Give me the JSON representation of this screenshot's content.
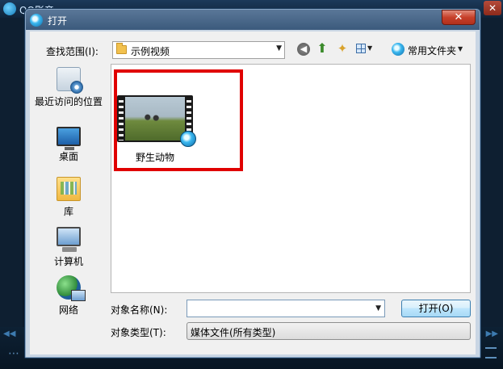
{
  "app": {
    "title": "QQ影音",
    "close_glyph": "✕"
  },
  "player": {
    "skip_left": "◀◀",
    "skip_right": "▶▶",
    "foot_icon": "⋯"
  },
  "dialog": {
    "title": "打开",
    "close_glyph": "✕",
    "look_in": {
      "label": "查找范围(I):",
      "value": "示例视频",
      "arrow": "▼"
    },
    "toolbar": {
      "back_glyph": "◀",
      "up_glyph": "⬆",
      "new_folder_glyph": "✦",
      "view_arrow": "▼",
      "favorites_label": "常用文件夹",
      "favorites_arrow": "▼"
    },
    "places": [
      {
        "label": "最近访问的位置",
        "icon": "recent-places-icon"
      },
      {
        "label": "桌面",
        "icon": "desktop-icon"
      },
      {
        "label": "库",
        "icon": "library-icon"
      },
      {
        "label": "计算机",
        "icon": "computer-icon"
      },
      {
        "label": "网络",
        "icon": "network-icon"
      }
    ],
    "files": [
      {
        "name": "野生动物",
        "type": "video"
      }
    ],
    "file_name": {
      "label": "对象名称(N):",
      "value": "",
      "arrow": "▼"
    },
    "file_type": {
      "label": "对象类型(T):",
      "value": "媒体文件(所有类型)"
    },
    "open_button": "打开(O)",
    "highlight_color": "#e00000"
  }
}
